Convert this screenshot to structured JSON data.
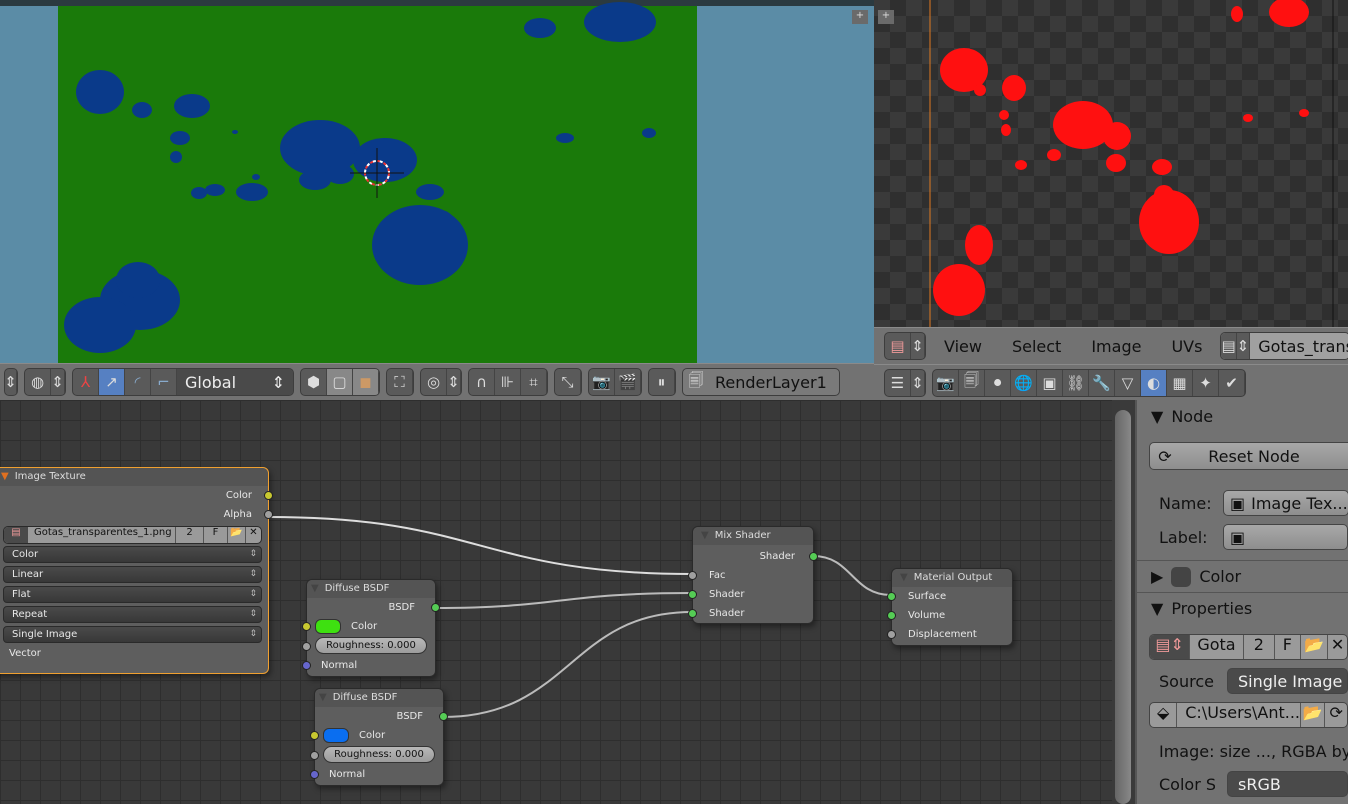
{
  "viewport": {
    "header": {
      "orientation": "Global",
      "render_layer": "RenderLayer1"
    },
    "colors": {
      "background": "#5b8ca6",
      "plane": "#1a7a0a",
      "blobs": "#0a3a8a"
    }
  },
  "image_editor": {
    "menus": [
      "View",
      "Select",
      "Image",
      "UVs"
    ],
    "image_name": "Gotas_trans",
    "colors": {
      "blobs": "#ff1010"
    }
  },
  "properties_tabs": [
    "render-icon",
    "render-layers-icon",
    "scene-icon",
    "world-icon",
    "object-icon",
    "constraints-icon",
    "modifier-icon",
    "data-icon",
    "material-icon",
    "texture-icon",
    "particles-icon",
    "physics-icon"
  ],
  "active_properties_tab": "material-icon",
  "nodes": {
    "image_texture": {
      "title": "Image Texture",
      "outputs": [
        "Color",
        "Alpha"
      ],
      "image": "Gotas_transparentes_1.png",
      "users": "2",
      "fake": "F",
      "color_space": "Color",
      "interpolation": "Linear",
      "projection": "Flat",
      "extension": "Repeat",
      "source": "Single Image",
      "input": "Vector"
    },
    "diffuse1": {
      "title": "Diffuse BSDF",
      "output": "BSDF",
      "color_label": "Color",
      "color": "#3ee010",
      "roughness": "Roughness: 0.000",
      "normal": "Normal"
    },
    "diffuse2": {
      "title": "Diffuse BSDF",
      "output": "BSDF",
      "color_label": "Color",
      "color": "#0a6ef0",
      "roughness": "Roughness: 0.000",
      "normal": "Normal"
    },
    "mix": {
      "title": "Mix Shader",
      "output": "Shader",
      "inputs": [
        "Fac",
        "Shader",
        "Shader"
      ]
    },
    "output": {
      "title": "Material Output",
      "inputs": [
        "Surface",
        "Volume",
        "Displacement"
      ]
    }
  },
  "sidebar": {
    "node_panel": "Node",
    "reset": "Reset Node",
    "name_label": "Name:",
    "name_value": "Image Tex...",
    "label_label": "Label:",
    "label_value": "",
    "color_panel": "Color",
    "properties_panel": "Properties",
    "image_short": "Gota",
    "users": "2",
    "fake": "F",
    "source_label": "Source",
    "source_value": "Single Image",
    "filepath": "C:\\Users\\Ant...",
    "image_info": "Image: size ..., RGBA byt",
    "colorspace_label": "Color S",
    "colorspace_value": "sRGB"
  }
}
